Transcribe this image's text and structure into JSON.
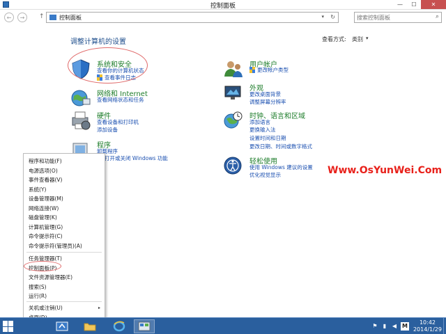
{
  "window": {
    "title": "控制面板",
    "minimize": "—",
    "maximize": "☐",
    "close": "✕"
  },
  "address": {
    "back": "←",
    "forward": "→",
    "up": "↑",
    "path": "控制面板",
    "path_caret": "▾",
    "refresh": "↻",
    "search_placeholder": "搜索控制面板",
    "search_glyph": "⌕"
  },
  "main": {
    "title": "调整计算机的设置",
    "view_by_label": "查看方式:",
    "view_by_value": "类别",
    "view_by_caret": "▾",
    "categories": [
      {
        "title": "系统和安全",
        "links": [
          "查看你的计算机状态",
          "查看事件日志"
        ]
      },
      {
        "title": "网络和 Internet",
        "links": [
          "查看网络状态和任务"
        ]
      },
      {
        "title": "硬件",
        "links": [
          "查看设备和打印机",
          "添加设备"
        ]
      },
      {
        "title": "程序",
        "links": [
          "卸载程序",
          "打开或关闭 Windows 功能"
        ]
      },
      {
        "title": "用户帐户",
        "links": [
          "更改帐户类型"
        ]
      },
      {
        "title": "外观",
        "links": [
          "更改桌面背景",
          "调整屏幕分辨率"
        ]
      },
      {
        "title": "时钟、语言和区域",
        "links": [
          "添加语言",
          "更换输入法",
          "设置时间和日期",
          "更改日期、时间或数字格式"
        ]
      },
      {
        "title": "轻松使用",
        "links": [
          "使用 Windows 建议的设置",
          "优化视觉显示"
        ]
      }
    ]
  },
  "watermark": "Www.OsYunWei.Com",
  "context_menu": {
    "items": [
      "程序和功能(F)",
      "电源选项(O)",
      "事件查看器(V)",
      "系统(Y)",
      "设备管理器(M)",
      "网络连接(W)",
      "磁盘管理(K)",
      "计算机管理(G)",
      "命令提示符(C)",
      "命令提示符(管理员)(A)",
      "任务管理器(T)",
      "控制面板(P)",
      "文件资源管理器(E)",
      "搜索(S)",
      "运行(R)",
      "关机或注销(U)",
      "桌面(D)"
    ],
    "submenu_arrow": "▸"
  },
  "taskbar": {
    "time": "10:42",
    "date": "2014/1/29",
    "ime": "M",
    "flag_glyph": "⚑",
    "network_glyph": "▮",
    "volume_glyph": "◀"
  },
  "colors": {
    "link": "#1a4fb0",
    "category_title": "#1e7d2b",
    "page_title": "#1e4e8c",
    "taskbar": "#2a5f9e",
    "highlight": "#e06a6a",
    "watermark": "#e8211b"
  }
}
